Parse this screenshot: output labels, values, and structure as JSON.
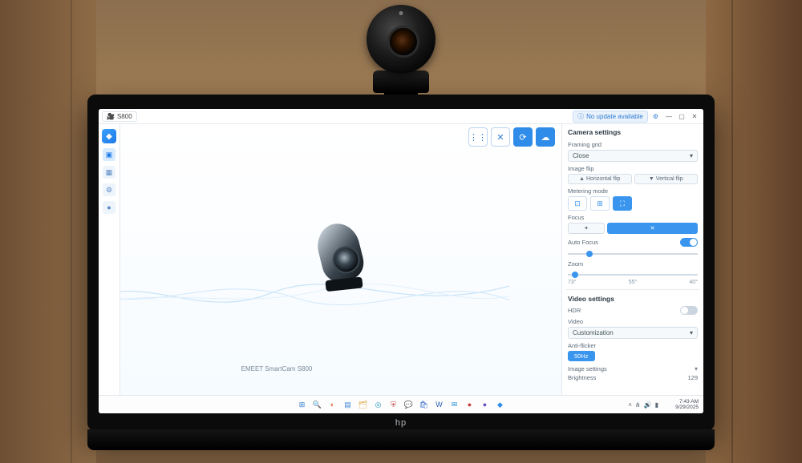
{
  "titlebar": {
    "device_name": "S800",
    "update_text": "No update available",
    "min": "—",
    "max": "▢",
    "close": "✕"
  },
  "leftrail": {
    "logo_glyph": "◆",
    "icons": [
      {
        "name": "camera-icon",
        "glyph": "▣"
      },
      {
        "name": "grid-icon",
        "glyph": "▦"
      },
      {
        "name": "settings-icon",
        "glyph": "⚙"
      },
      {
        "name": "mic-icon",
        "glyph": "●"
      }
    ]
  },
  "main": {
    "product_label": "EMEET SmartCam S800",
    "top_icons": [
      {
        "name": "audio-icon",
        "glyph": "⋮⋮",
        "filled": false
      },
      {
        "name": "tools-icon",
        "glyph": "✕",
        "filled": false
      },
      {
        "name": "refresh-icon",
        "glyph": "⟳",
        "filled": true
      },
      {
        "name": "chat-icon",
        "glyph": "☁",
        "filled": true
      }
    ]
  },
  "panel": {
    "camera_settings_title": "Camera settings",
    "framing_grid_label": "Framing grid",
    "framing_grid_value": "Close",
    "image_flip_label": "Image flip",
    "flip_h": "Horizontal flip",
    "flip_v": "Vertical flip",
    "metering_label": "Metering mode",
    "metering_opts": [
      "⊡",
      "⊞",
      "⛶"
    ],
    "focus_label": "Focus",
    "focus_opts": [
      "✦",
      "✕"
    ],
    "auto_focus_label": "Auto Focus",
    "zoom_label": "Zoom",
    "zoom_ticks": [
      "73°",
      "55°",
      "40°"
    ],
    "video_settings_title": "Video settings",
    "hdr_label": "HDR",
    "video_label": "Video",
    "video_value": "Customization",
    "anti_flicker_label": "Anti-flicker",
    "anti_flicker_btn": "50Hz",
    "image_settings_label": "Image settings",
    "brightness_label": "Brightness",
    "brightness_value": "129"
  },
  "taskbar": {
    "icons": [
      {
        "name": "start-icon",
        "glyph": "⊞",
        "color": "#2f7dd1"
      },
      {
        "name": "search-icon",
        "glyph": "🔍",
        "color": "#4a4a4a"
      },
      {
        "name": "copilot-icon",
        "glyph": "◐",
        "color": "#e16a3d"
      },
      {
        "name": "widgets-icon",
        "glyph": "▤",
        "color": "#3d87d4"
      },
      {
        "name": "explorer-icon",
        "glyph": "🗂",
        "color": "#e0a43a"
      },
      {
        "name": "edge-icon",
        "glyph": "◎",
        "color": "#1b8fbf"
      },
      {
        "name": "shield-icon",
        "glyph": "⛨",
        "color": "#c14747"
      },
      {
        "name": "chat-icon",
        "glyph": "💬",
        "color": "#55a04a"
      },
      {
        "name": "store-icon",
        "glyph": "🛍",
        "color": "#3366cc"
      },
      {
        "name": "word-icon",
        "glyph": "W",
        "color": "#2a5db0"
      },
      {
        "name": "mail-icon",
        "glyph": "✉",
        "color": "#1f8bd1"
      },
      {
        "name": "app1-icon",
        "glyph": "●",
        "color": "#c43e3e"
      },
      {
        "name": "app2-icon",
        "glyph": "●",
        "color": "#6d4fc1"
      },
      {
        "name": "app3-icon",
        "glyph": "◆",
        "color": "#2f8ce8"
      }
    ],
    "tray": {
      "bat": "▮",
      "wifi": "⋔",
      "vol": "🔊"
    },
    "time": "7:43 AM",
    "date": "9/29/2025"
  },
  "laptop_brand": "hp"
}
